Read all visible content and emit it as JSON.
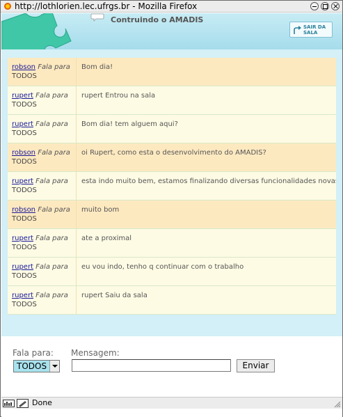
{
  "window": {
    "title": "http://lothlorien.lec.ufrgs.br - Mozilla Firefox"
  },
  "header": {
    "room_title": "Contruindo o AMADIS",
    "exit_button": "SAIR DA SALA"
  },
  "messages": [
    {
      "user": "robson",
      "says": "Fala para",
      "to": "TODOS",
      "text": "Bom dia!",
      "style": "odd"
    },
    {
      "user": "rupert",
      "says": "Fala para",
      "to": "TODOS",
      "text": "rupert Entrou na sala",
      "style": "even"
    },
    {
      "user": "rupert",
      "says": "Fala para",
      "to": "TODOS",
      "text": "Bom dia! tem alguem aqui?",
      "style": "even"
    },
    {
      "user": "robson",
      "says": "Fala para",
      "to": "TODOS",
      "text": "oi Rupert, como esta o desenvolvimento do AMADIS?",
      "style": "odd"
    },
    {
      "user": "rupert",
      "says": "Fala para",
      "to": "TODOS",
      "text": "esta indo muito bem, estamos finalizando diversas funcionalidades novas",
      "style": "even"
    },
    {
      "user": "robson",
      "says": "Fala para",
      "to": "TODOS",
      "text": "muito bom",
      "style": "odd"
    },
    {
      "user": "rupert",
      "says": "Fala para",
      "to": "TODOS",
      "text": "ate a proximal",
      "style": "even"
    },
    {
      "user": "rupert",
      "says": "Fala para",
      "to": "TODOS",
      "text": "eu vou indo, tenho q continuar com o trabalho",
      "style": "even"
    },
    {
      "user": "rupert",
      "says": "Fala para",
      "to": "TODOS",
      "text": "rupert Saiu da sala",
      "style": "even"
    }
  ],
  "form": {
    "recipient_label": "Fala para:",
    "recipient_value": "TODOS",
    "message_label": "Mensagem:",
    "message_value": "",
    "send_button": "Enviar"
  },
  "status": {
    "text": "Done"
  },
  "colors": {
    "header_bg": "#a6dcec",
    "puzzle": "#3fc7a8",
    "row_odd": "#fde9c0",
    "row_even": "#fdfbe4",
    "link": "#1a1a99"
  }
}
